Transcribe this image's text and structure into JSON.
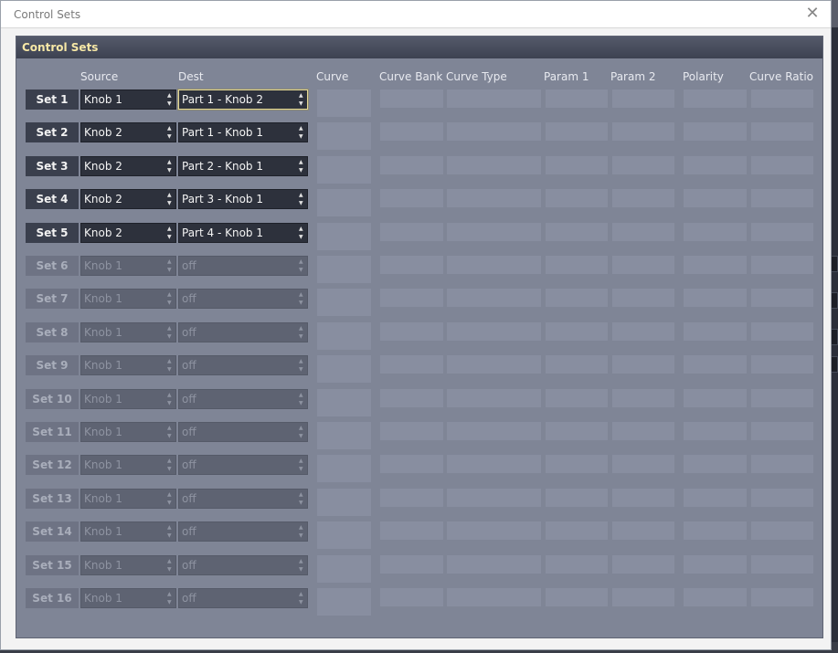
{
  "window": {
    "title": "Control Sets",
    "close_glyph": "✕"
  },
  "panel": {
    "title": "Control Sets"
  },
  "columns": {
    "source": "Source",
    "dest": "Dest",
    "curve": "Curve",
    "curve_bank": "Curve Bank",
    "curve_type": "Curve Type",
    "param1": "Param 1",
    "param2": "Param 2",
    "polarity": "Polarity",
    "curve_ratio": "Curve Ratio"
  },
  "rows": [
    {
      "label": "Set 1",
      "source": "Knob 1",
      "dest": "Part 1 - Knob 2",
      "enabled": true,
      "focused": true
    },
    {
      "label": "Set 2",
      "source": "Knob 2",
      "dest": "Part 1 - Knob 1",
      "enabled": true
    },
    {
      "label": "Set 3",
      "source": "Knob 2",
      "dest": "Part 2 - Knob 1",
      "enabled": true
    },
    {
      "label": "Set 4",
      "source": "Knob 2",
      "dest": "Part 3 - Knob 1",
      "enabled": true
    },
    {
      "label": "Set 5",
      "source": "Knob 2",
      "dest": "Part 4 - Knob 1",
      "enabled": true
    },
    {
      "label": "Set 6",
      "source": "Knob 1",
      "dest": "off",
      "enabled": false
    },
    {
      "label": "Set 7",
      "source": "Knob 1",
      "dest": "off",
      "enabled": false
    },
    {
      "label": "Set 8",
      "source": "Knob 1",
      "dest": "off",
      "enabled": false
    },
    {
      "label": "Set 9",
      "source": "Knob 1",
      "dest": "off",
      "enabled": false
    },
    {
      "label": "Set 10",
      "source": "Knob 1",
      "dest": "off",
      "enabled": false
    },
    {
      "label": "Set 11",
      "source": "Knob 1",
      "dest": "off",
      "enabled": false
    },
    {
      "label": "Set 12",
      "source": "Knob 1",
      "dest": "off",
      "enabled": false
    },
    {
      "label": "Set 13",
      "source": "Knob 1",
      "dest": "off",
      "enabled": false
    },
    {
      "label": "Set 14",
      "source": "Knob 1",
      "dest": "off",
      "enabled": false
    },
    {
      "label": "Set 15",
      "source": "Knob 1",
      "dest": "off",
      "enabled": false
    },
    {
      "label": "Set 16",
      "source": "Knob 1",
      "dest": "off",
      "enabled": false
    }
  ],
  "colors": {
    "panel_bg": "#7f8596",
    "header_text": "#f7e8a6",
    "combo_bg": "#2d313c",
    "focus_border": "#e6d995"
  },
  "icons": {
    "close": "close-icon",
    "spinner": "updown-arrows-icon"
  }
}
